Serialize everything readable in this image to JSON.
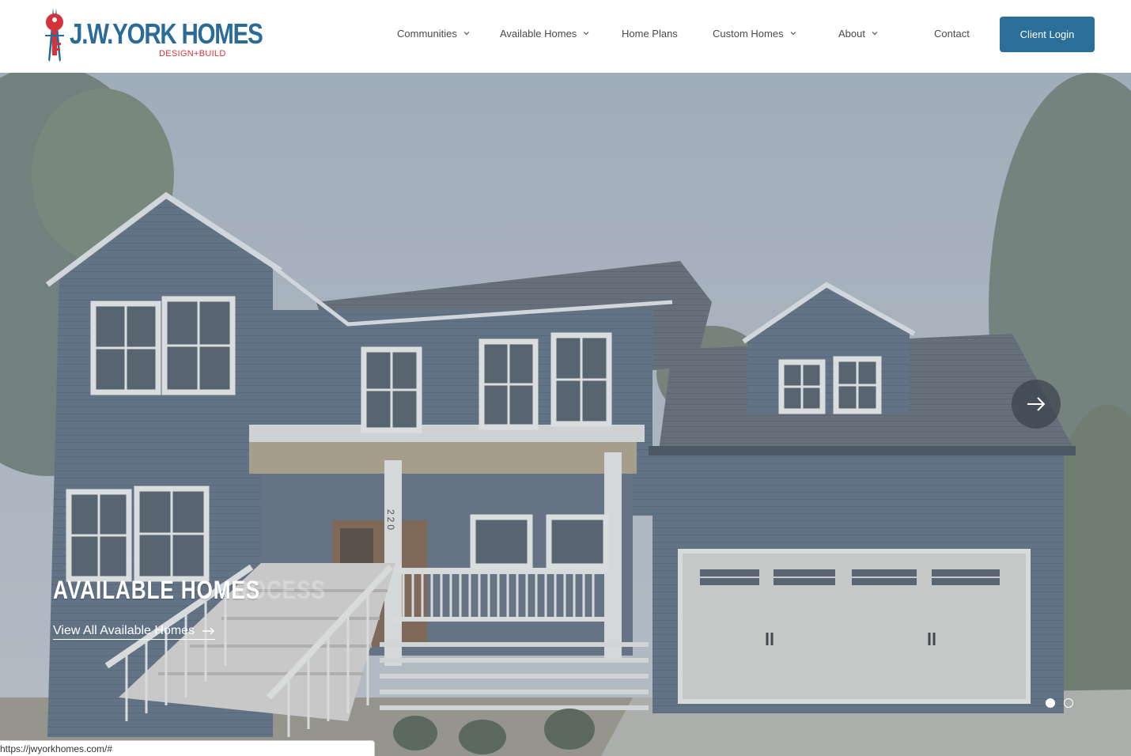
{
  "brand": {
    "name": "J.W.YORK HOMES",
    "tagline": "DESIGN+BUILD",
    "primary_color": "#2a6e99",
    "accent_color": "#d3343b"
  },
  "nav": {
    "items": [
      {
        "label": "Communities",
        "has_dropdown": true
      },
      {
        "label": "Available Homes",
        "has_dropdown": true
      },
      {
        "label": "Home Plans",
        "has_dropdown": false
      },
      {
        "label": "Custom Homes",
        "has_dropdown": true
      },
      {
        "label": "About",
        "has_dropdown": true
      },
      {
        "label": "Contact",
        "has_dropdown": false
      }
    ],
    "login_label": "Client Login"
  },
  "hero": {
    "slide_title": "AVAILABLE HOMES",
    "ghost_title": "ROCESS",
    "cta_label": "View All Available Homes",
    "house_number": "220",
    "next_icon": "arrow-right-icon",
    "slide_count": 2,
    "active_slide": 1
  },
  "status_bar": {
    "url": "https://jwyorkhomes.com/#"
  }
}
